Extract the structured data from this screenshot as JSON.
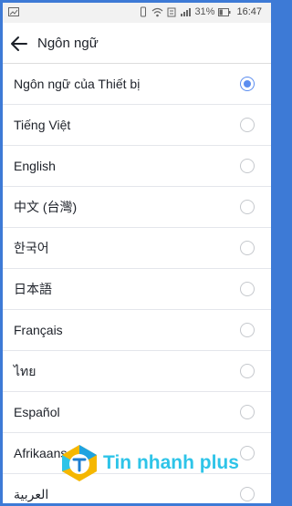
{
  "status_bar": {
    "battery": "31%",
    "time": "16:47"
  },
  "app_bar": {
    "title": "Ngôn ngữ"
  },
  "languages": [
    {
      "label": "Ngôn ngữ của Thiết bị",
      "selected": true
    },
    {
      "label": "Tiếng Việt",
      "selected": false
    },
    {
      "label": "English",
      "selected": false
    },
    {
      "label": "中文 (台灣)",
      "selected": false
    },
    {
      "label": "한국어",
      "selected": false
    },
    {
      "label": "日本語",
      "selected": false
    },
    {
      "label": "Français",
      "selected": false
    },
    {
      "label": "ไทย",
      "selected": false
    },
    {
      "label": "Español",
      "selected": false
    },
    {
      "label": "Afrikaans",
      "selected": false
    },
    {
      "label": "العربية",
      "selected": false
    }
  ],
  "watermark": {
    "text": "Tin nhanh plus"
  },
  "colors": {
    "accent": "#5b8def",
    "frame": "#3d7ad6"
  }
}
